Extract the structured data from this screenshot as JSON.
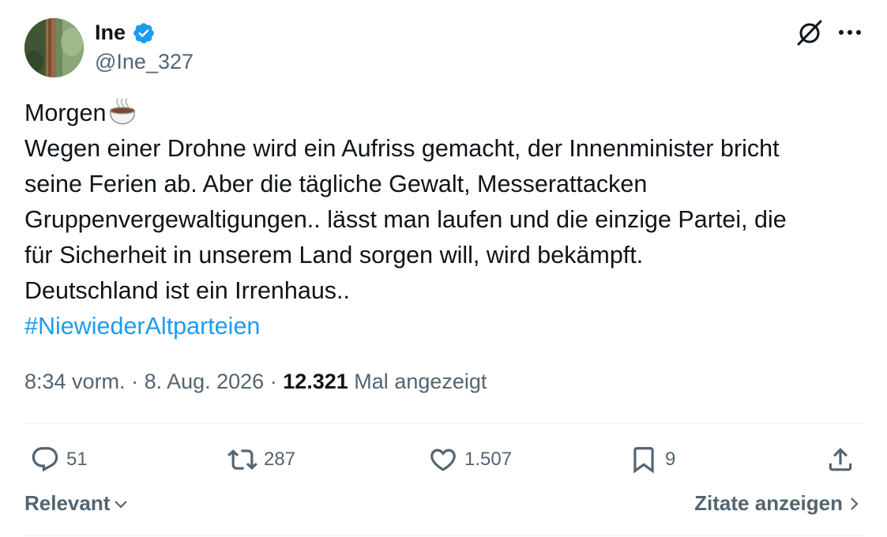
{
  "author": {
    "name": "Ine",
    "handle": "@Ine_327"
  },
  "icons": {
    "verified": "verified-badge-icon",
    "grok": "grok-icon",
    "more": "more-icon",
    "coffee": "hot-beverage-emoji"
  },
  "tweet": {
    "line1": "Morgen",
    "line2": "Wegen einer Drohne wird ein Aufriss gemacht, der Innenminister bricht",
    "line3": "seine Ferien ab. Aber die tägliche Gewalt, Messerattacken",
    "line4": "Gruppenvergewaltigungen.. lässt man laufen und die einzige Partei, die",
    "line5": "für Sicherheit in unserem Land sorgen will, wird bekämpft.",
    "line6": "Deutschland ist ein Irrenhaus..",
    "hashtag": "#NiewiederAltparteien"
  },
  "meta": {
    "time": "8:34 vorm.",
    "sep1": " · ",
    "date": "8. Aug. 2026",
    "sep2": " · ",
    "views": "12.321",
    "views_label": " Mal angezeigt"
  },
  "actions": {
    "replies": "51",
    "reposts": "287",
    "likes": "1.507",
    "bookmarks": "9"
  },
  "footer": {
    "sort_label": "Relevant",
    "quotes_label": "Zitate anzeigen"
  },
  "colors": {
    "accent": "#1d9bf0",
    "secondary_text": "#536471",
    "primary_text": "#0f1419"
  }
}
